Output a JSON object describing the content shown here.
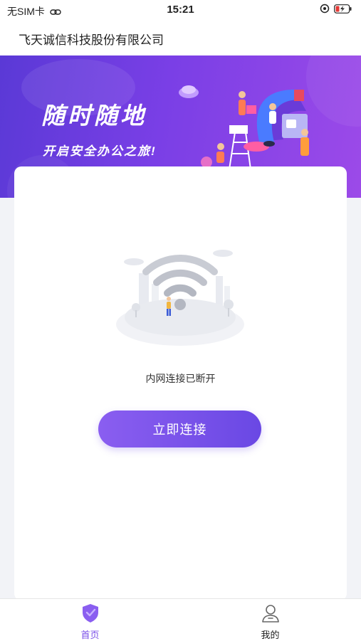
{
  "status_bar": {
    "carrier": "无SIM卡",
    "time": "15:21"
  },
  "header": {
    "title": "飞天诚信科技股份有限公司"
  },
  "banner": {
    "title": "随时随地",
    "subtitle": "开启安全办公之旅!"
  },
  "main": {
    "status_text": "内网连接已断开",
    "connect_label": "立即连接"
  },
  "tabbar": {
    "tabs": [
      {
        "label": "首页",
        "icon": "shield-icon",
        "active": true
      },
      {
        "label": "我的",
        "icon": "person-icon",
        "active": false
      }
    ]
  },
  "colors": {
    "accent": "#7a4fe8",
    "banner_start": "#5a39d6",
    "banner_end": "#9c4ae8"
  }
}
